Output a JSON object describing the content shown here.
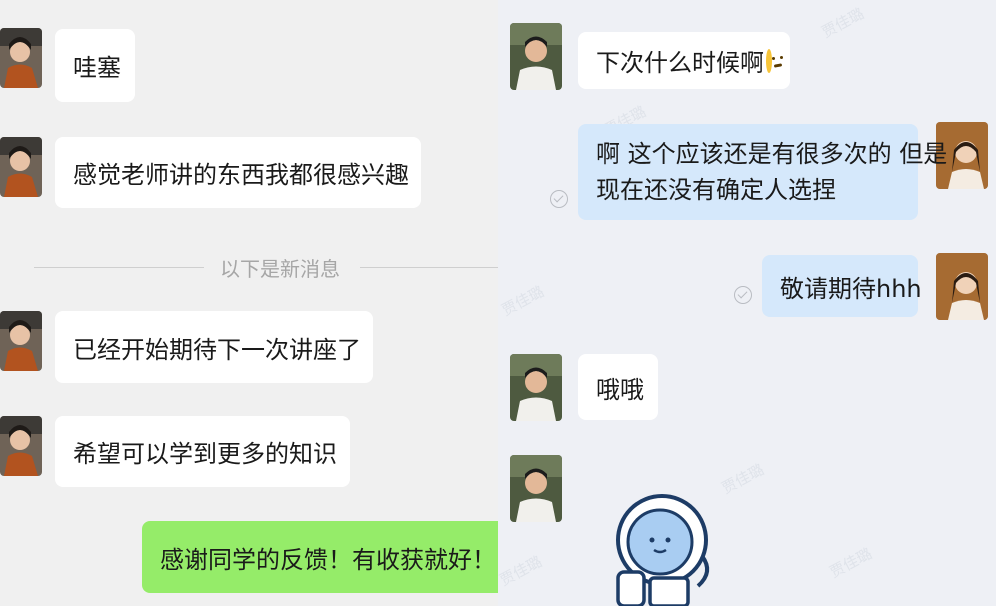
{
  "left_chat": {
    "messages": [
      {
        "text": "哇塞"
      },
      {
        "text": "感觉老师讲的东西我都很感兴趣"
      },
      {
        "text": "已经开始期待下一次讲座了"
      },
      {
        "text": "希望可以学到更多的知识"
      },
      {
        "text": "感谢同学的反馈！有收获就好！"
      }
    ],
    "divider": "以下是新消息"
  },
  "right_chat": {
    "messages": [
      {
        "text": "下次什么时候啊"
      },
      {
        "line1": "啊 这个应该还是有很多次的 但是",
        "line2": "现在还没有确定人选捏"
      },
      {
        "text": "敬请期待hhh"
      },
      {
        "text": "哦哦"
      }
    ],
    "watermark": "贾佳璐",
    "emoji_name": "thinking-face-emoji",
    "sticker_name": "astronaut-sticker"
  },
  "colors": {
    "incoming_bubble": "#ffffff",
    "outgoing_bubble_green": "#95ec69",
    "outgoing_bubble_blue": "#d5e8fb"
  }
}
